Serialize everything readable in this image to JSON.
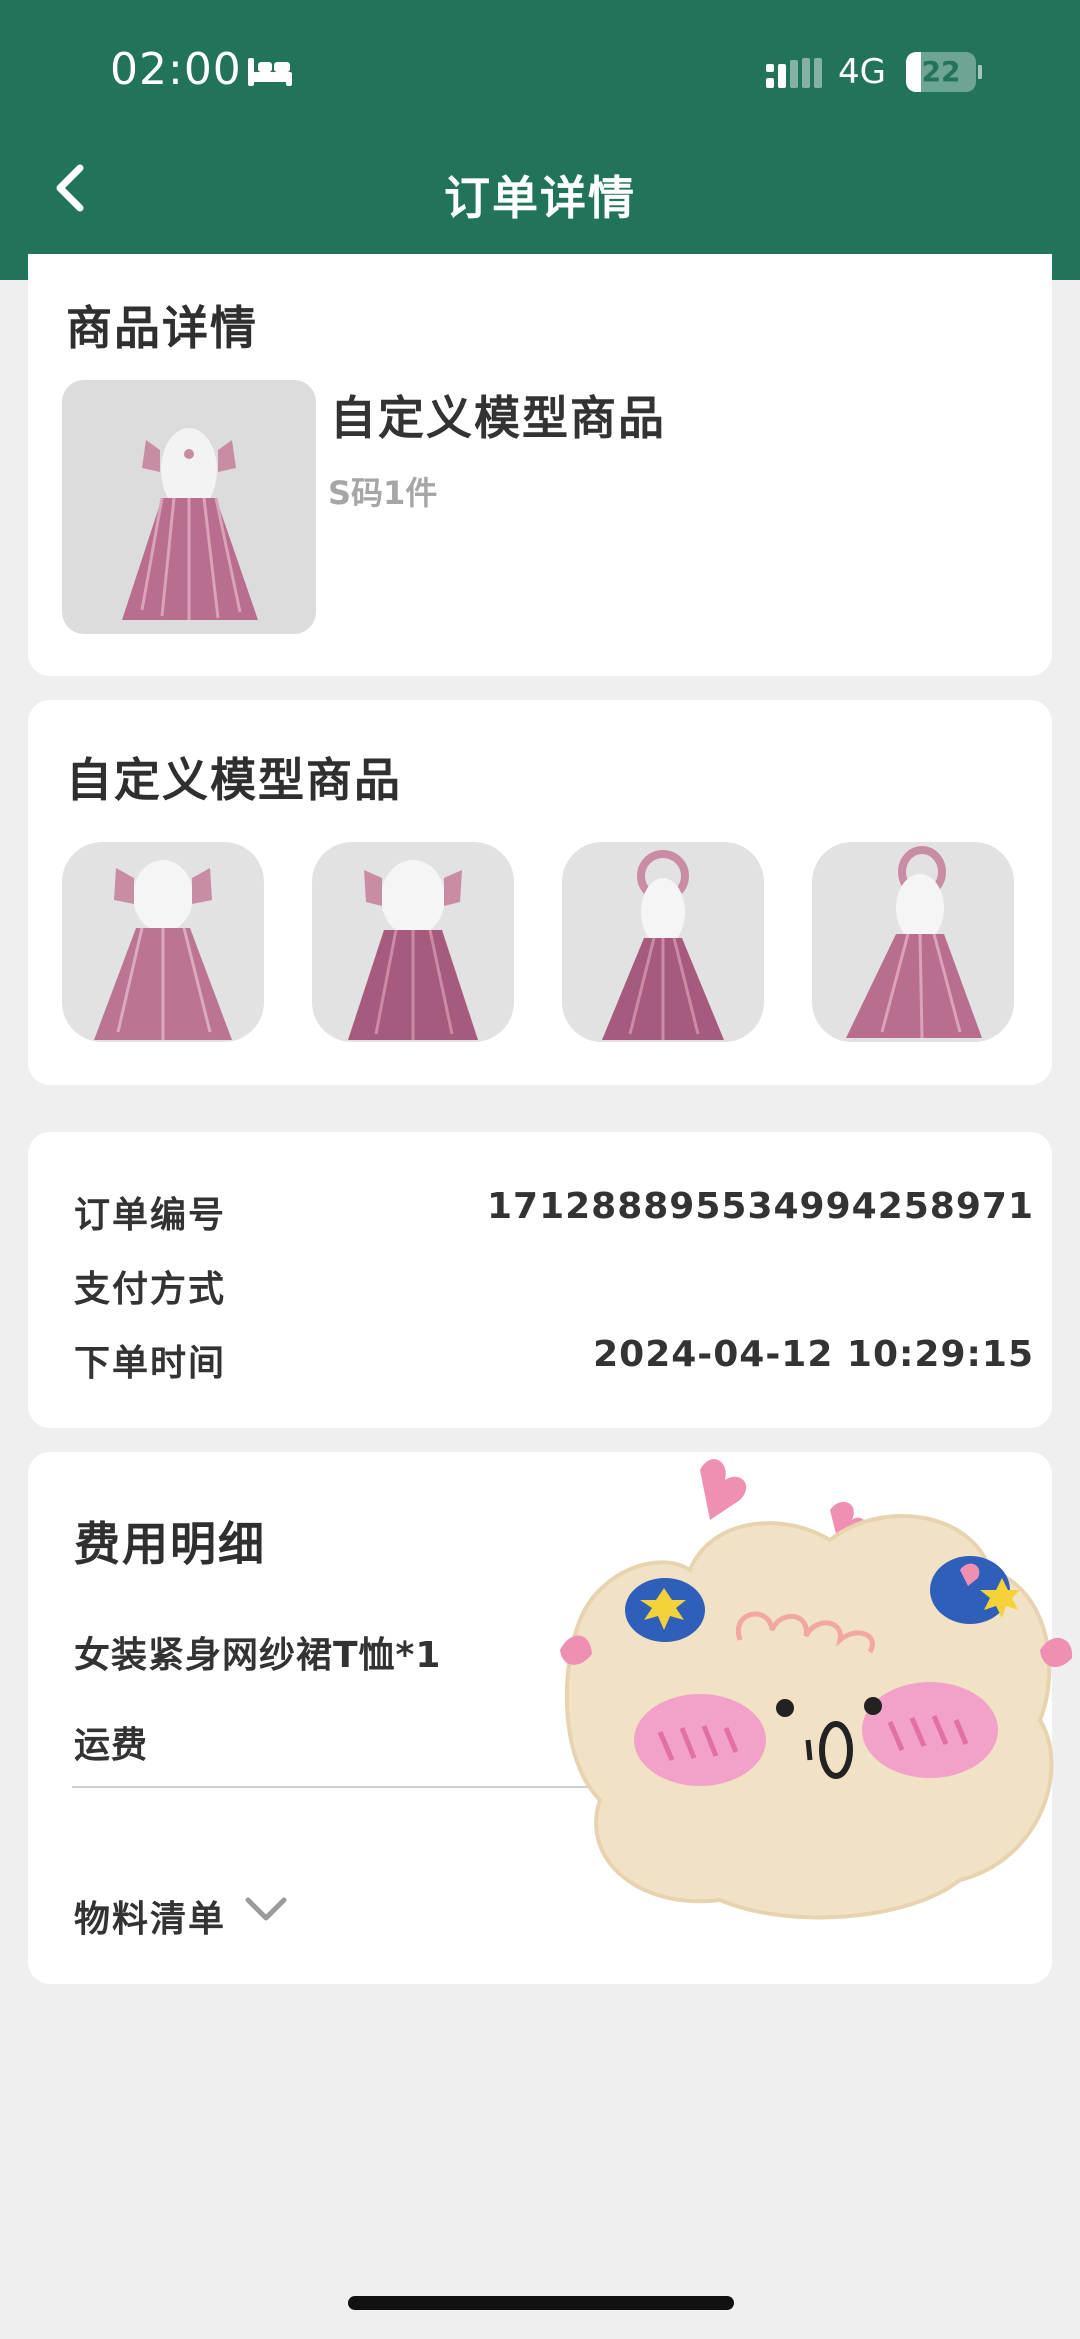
{
  "status_bar": {
    "time": "02:00",
    "network": "4G",
    "battery": "22",
    "battery_level": 0.22
  },
  "nav": {
    "title": "订单详情"
  },
  "product_section": {
    "title": "商品详情",
    "product_name": "自定义模型商品",
    "spec": "S码1件"
  },
  "gallery_section": {
    "title": "自定义模型商品"
  },
  "order_info": {
    "order_number_label": "订单编号",
    "order_number": "17128889553499425897​1",
    "payment_label": "支付方式",
    "payment_value": "",
    "time_label": "下单时间",
    "time_value": "2024-04-12 10:29:15"
  },
  "fees": {
    "title": "费用明细",
    "item_label": "女装紧身网纱裙T恤*1",
    "shipping_label": "运费",
    "materials_label": "物料清单"
  },
  "colors": {
    "header": "#21735b",
    "background": "#efefef"
  },
  "icons": [
    "back-arrow-icon",
    "sleep-icon",
    "signal-icon",
    "battery-icon",
    "chevron-down-icon"
  ]
}
